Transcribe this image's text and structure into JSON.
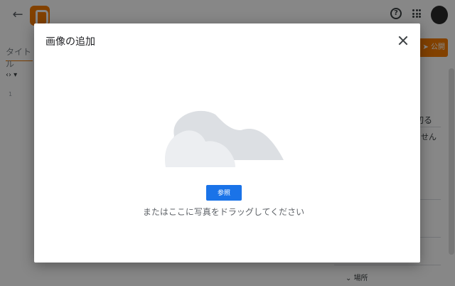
{
  "editor": {
    "back_icon": "arrow-left-icon",
    "logo_icon": "blogger-logo-icon",
    "help_icon": "help-circle-icon",
    "help_glyph": "?",
    "apps_icon": "apps-grid-icon",
    "title_placeholder": "タイトル",
    "publish_label": "公開",
    "publish_icon": "send-icon",
    "sidebar_text_1": "切る",
    "sidebar_text_2": "せん",
    "place_label": "場所",
    "colors": {
      "brand": "#f57c00",
      "overlay": "rgba(0,0,0,0.47)"
    }
  },
  "dialog": {
    "title": "画像の追加",
    "close_icon": "close-icon",
    "illustration": "cloud-illustration",
    "browse_label": "参照",
    "drop_hint": "またはここに写真をドラッグしてください",
    "colors": {
      "accent": "#1a73e8",
      "cloud_light": "#eceef1",
      "cloud_dark": "#dcdfe3"
    }
  }
}
